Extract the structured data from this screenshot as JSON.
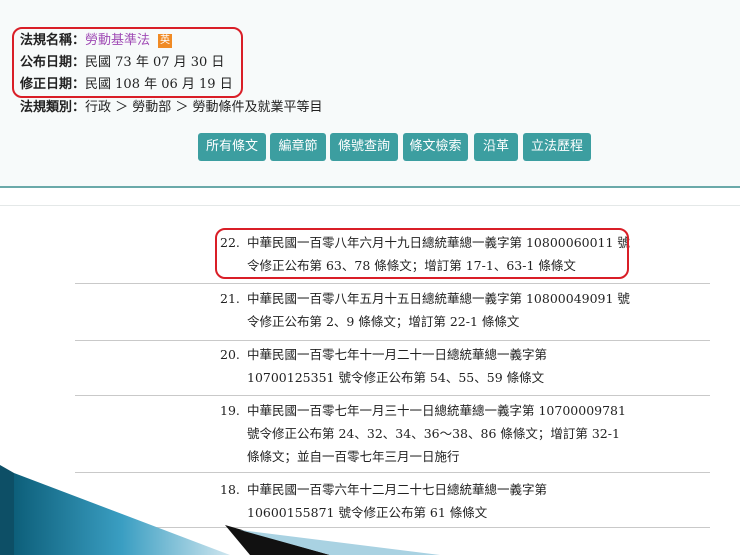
{
  "header": {
    "name_label": "法規名稱：",
    "name_value": "勞動基準法",
    "en_badge": "英",
    "publish_label": "公布日期：",
    "publish_value": "民國 73 年 07 月 30 日",
    "amend_label": "修正日期：",
    "amend_value": "民國 108 年 06 月 19 日",
    "category_label": "法規類別：",
    "category_value": "行政 ＞ 勞動部 ＞ 勞動條件及就業平等目"
  },
  "buttons": [
    "所有條文",
    "編章節",
    "條號查詢",
    "條文檢索",
    "沿革",
    "立法歷程"
  ],
  "entries": [
    {
      "num": "22.",
      "text": "中華民國一百零八年六月十九日總統華總一義字第 10800060011 號令修正公布第 63、78 條條文；增訂第 17-1、63-1 條條文"
    },
    {
      "num": "21.",
      "text": "中華民國一百零八年五月十五日總統華總一義字第 10800049091 號令修正公布第 2、9 條條文；增訂第 22-1 條條文"
    },
    {
      "num": "20.",
      "text": "中華民國一百零七年十一月二十一日總統華總一義字第 10700125351 號令修正公布第 54、55、59 條條文"
    },
    {
      "num": "19.",
      "text": "中華民國一百零七年一月三十一日總統華總一義字第 10700009781 號令修正公布第 24、32、34、36～38、86 條條文；增訂第 32-1 條條文；並自一百零七年三月一日施行"
    },
    {
      "num": "18.",
      "text": "中華民國一百零六年十二月二十七日總統華總一義字第 10600155871 號令修正公布第 61 條條文"
    }
  ],
  "colors": {
    "accent": "#3c9ea0",
    "highlight": "#d91e27",
    "name": "#a04cb5"
  }
}
